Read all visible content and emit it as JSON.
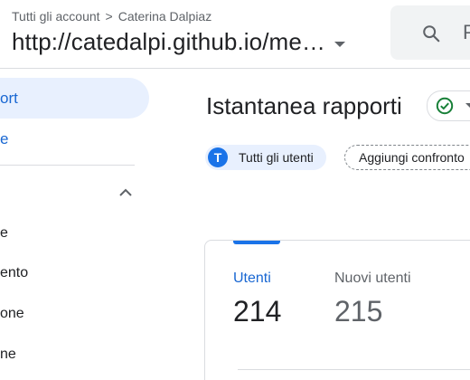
{
  "header": {
    "breadcrumb": {
      "account_scope": "Tutti gli account",
      "account_name": "Caterina Dalpiaz"
    },
    "property_name": "http://catedalpi.github.io/me…",
    "search_placeholder": "P"
  },
  "sidebar": {
    "active_item_label": "ort",
    "item2_label": "e",
    "sub_items": [
      {
        "label": "e"
      },
      {
        "label": "ento"
      },
      {
        "label": "one"
      },
      {
        "label": "ne"
      }
    ]
  },
  "main": {
    "title": "Istantanea rapporti",
    "segment": {
      "avatar_letter": "T",
      "label": "Tutti gli utenti"
    },
    "compare_label": "Aggiungi confronto",
    "metrics": [
      {
        "label": "Utenti",
        "value": "214",
        "selected": true
      },
      {
        "label": "Nuovi utenti",
        "value": "215",
        "selected": false
      }
    ]
  },
  "colors": {
    "accent": "#1a73e8",
    "status_ok": "#188038",
    "active_nav_bg": "#e8f0fe",
    "divider": "#dadce0"
  },
  "icons": {
    "search": "search-icon",
    "caret": "chevron-down-icon",
    "collapse": "chevron-up-icon",
    "status": "check-circle-icon"
  }
}
